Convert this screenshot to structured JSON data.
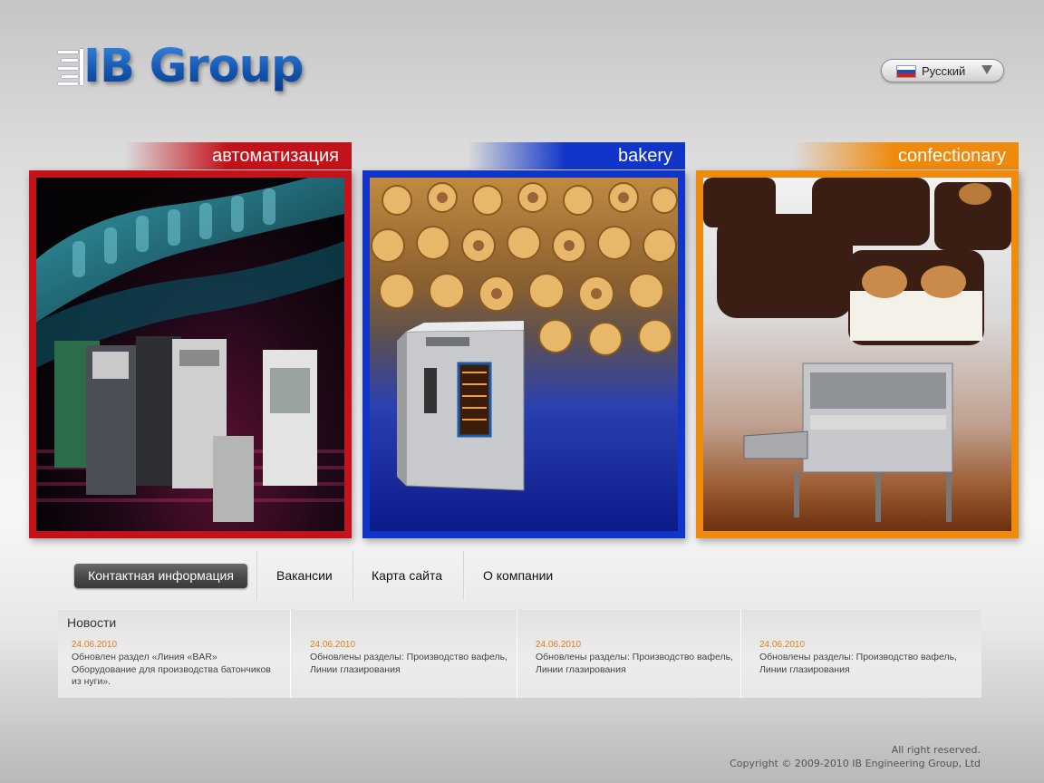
{
  "logo": {
    "text": "IB Group"
  },
  "language": {
    "selected": "Русский",
    "flag_colors": [
      "#ffffff",
      "#1a4fc4",
      "#d62020"
    ]
  },
  "panels": [
    {
      "label": "автоматизация",
      "color": "#c4121a"
    },
    {
      "label": "bakery",
      "color": "#1235c9"
    },
    {
      "label": "confectionary",
      "color": "#f08a0c"
    }
  ],
  "nav": {
    "items": [
      {
        "label": "Контактная информация",
        "active": true
      },
      {
        "label": "Вакансии"
      },
      {
        "label": "Карта сайта"
      },
      {
        "label": "О компании"
      }
    ]
  },
  "news": {
    "title": "Новости",
    "items": [
      {
        "date": "24.06.2010",
        "text": "Обновлен раздел «Линия «BAR» Оборудование для производства батончиков из нуги»."
      },
      {
        "date": "24.06.2010",
        "text": "Обновлены разделы: Производство вафель, Линии глазирования"
      },
      {
        "date": "24.06.2010",
        "text": "Обновлены разделы: Производство вафель, Линии глазирования"
      },
      {
        "date": "24.06.2010",
        "text": "Обновлены разделы: Производство вафель, Линии глазирования"
      }
    ]
  },
  "footer": {
    "rights": "All right reserved.",
    "copyright": "Copyright © 2009-2010 IB Engineering Group, Ltd"
  }
}
